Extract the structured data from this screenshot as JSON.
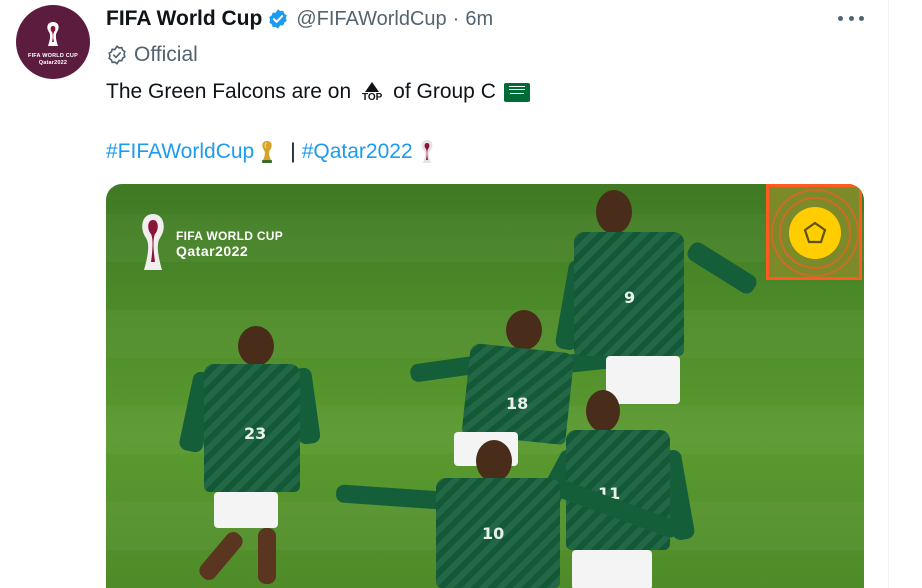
{
  "account": {
    "display_name": "FIFA World Cup",
    "handle": "@FIFAWorldCup",
    "separator": "·",
    "timestamp": "6m",
    "official_label": "Official",
    "avatar_text_line1": "FIFA WORLD CUP",
    "avatar_text_line2": "Qatar2022"
  },
  "tweet": {
    "text_before": "The Green Falcons are on",
    "top_emoji_text": "TOP",
    "text_after": "of Group C",
    "hashtag_1": "#FIFAWorldCup",
    "separator": "|",
    "hashtag_2": "#Qatar2022"
  },
  "media": {
    "logo_line1": "FIFA WORLD CUP",
    "logo_line2": "Qatar2022",
    "player_numbers": [
      "23",
      "18",
      "9",
      "10",
      "11"
    ]
  },
  "icons": {
    "verified": "verified-badge-icon",
    "official": "official-check-icon",
    "more": "more-options-icon",
    "top_arrow": "top-arrow-emoji",
    "flag": "saudi-flag-emoji",
    "trophy": "trophy-emoji",
    "mascot": "qatar-2022-emblem-emoji"
  },
  "colors": {
    "link": "#1d9bf0",
    "verified": "#1d9bf0",
    "secondary_text": "#536471",
    "jersey_green": "#145e3a",
    "badge_orange": "#ff5a1f",
    "badge_yellow": "#ffcd00"
  }
}
